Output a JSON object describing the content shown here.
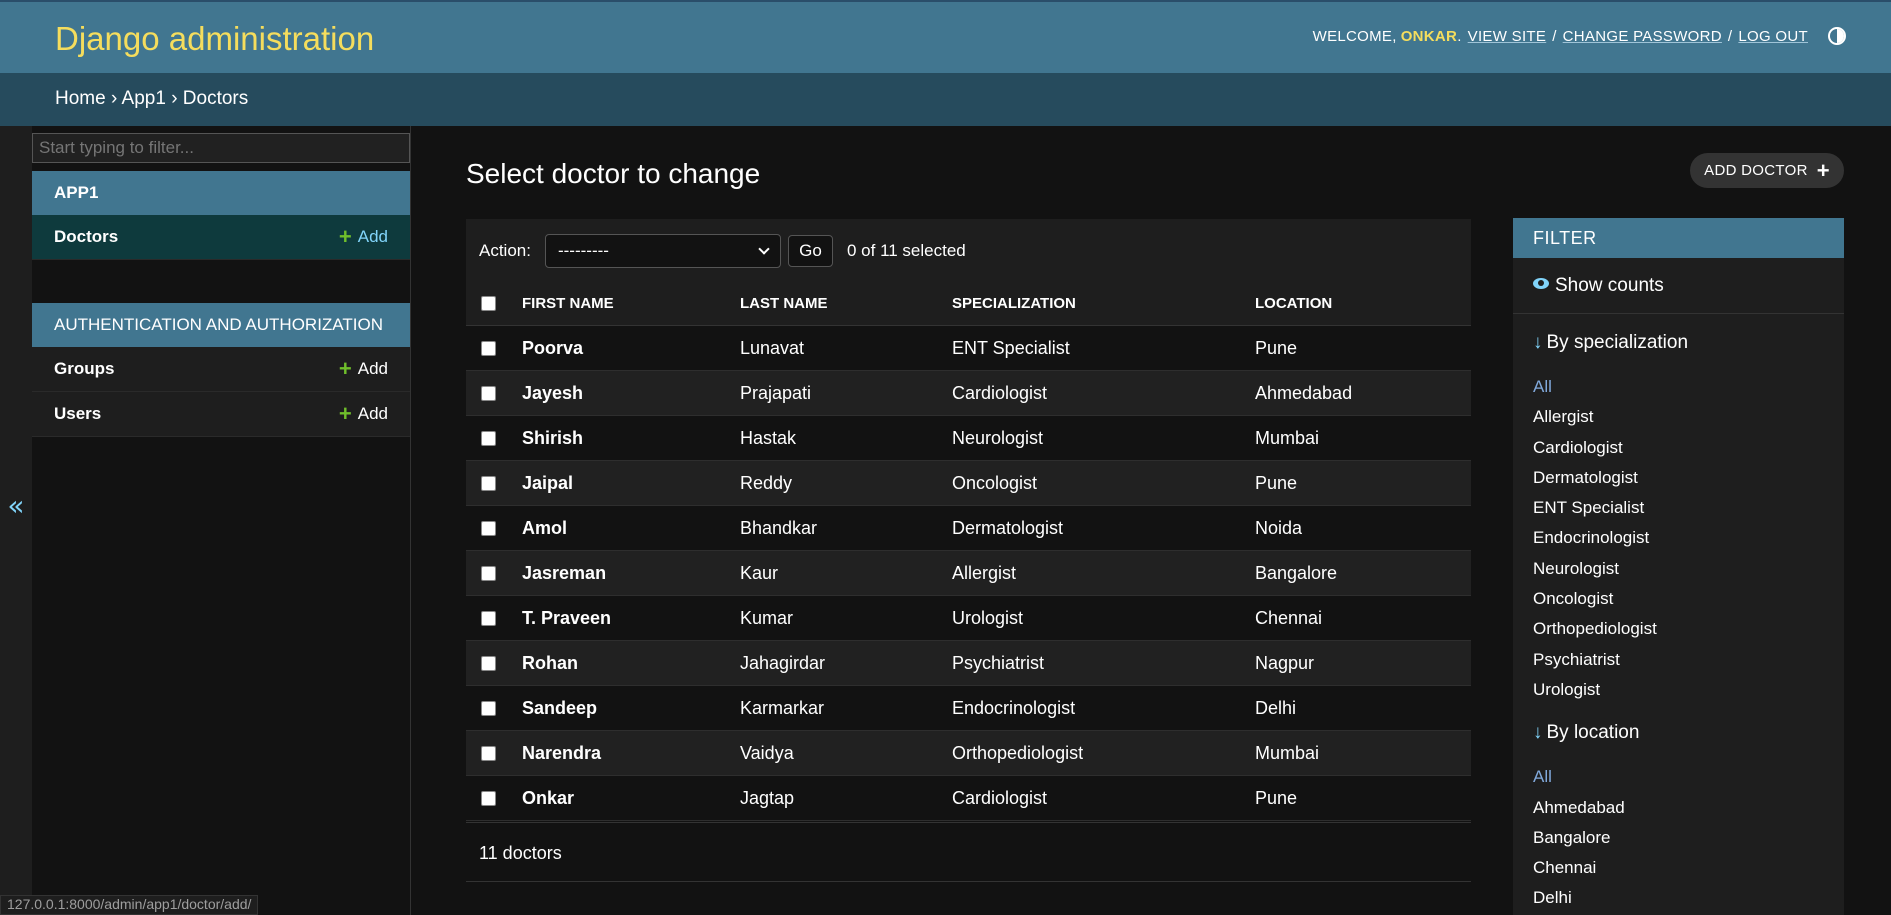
{
  "header": {
    "site_name": "Django administration",
    "welcome": "WELCOME,",
    "username": "ONKAR",
    "view_site": "VIEW SITE",
    "change_password": "CHANGE PASSWORD",
    "log_out": "LOG OUT",
    "theme_icon": "theme-toggle-icon"
  },
  "breadcrumbs": {
    "home": "Home",
    "app": "App1",
    "current": "Doctors",
    "separator": "›"
  },
  "sidebar": {
    "filter_placeholder": "Start typing to filter...",
    "toggle": "«",
    "modules": [
      {
        "caption": "APP1",
        "models": [
          {
            "name": "Doctors",
            "add": "Add"
          }
        ]
      },
      {
        "caption": "AUTHENTICATION AND AUTHORIZATION",
        "models": [
          {
            "name": "Groups",
            "add": "Add"
          },
          {
            "name": "Users",
            "add": "Add"
          }
        ]
      }
    ]
  },
  "main": {
    "title": "Select doctor to change",
    "add_button": "ADD DOCTOR",
    "actions": {
      "label": "Action:",
      "selected_value": "---------",
      "go": "Go",
      "counter": "0 of 11 selected"
    },
    "table": {
      "headers": [
        "FIRST NAME",
        "LAST NAME",
        "SPECIALIZATION",
        "LOCATION"
      ],
      "rows": [
        [
          "Poorva",
          "Lunavat",
          "ENT Specialist",
          "Pune"
        ],
        [
          "Jayesh",
          "Prajapati",
          "Cardiologist",
          "Ahmedabad"
        ],
        [
          "Shirish",
          "Hastak",
          "Neurologist",
          "Mumbai"
        ],
        [
          "Jaipal",
          "Reddy",
          "Oncologist",
          "Pune"
        ],
        [
          "Amol",
          "Bhandkar",
          "Dermatologist",
          "Noida"
        ],
        [
          "Jasreman",
          "Kaur",
          "Allergist",
          "Bangalore"
        ],
        [
          "T. Praveen",
          "Kumar",
          "Urologist",
          "Chennai"
        ],
        [
          "Rohan",
          "Jahagirdar",
          "Psychiatrist",
          "Nagpur"
        ],
        [
          "Sandeep",
          "Karmarkar",
          "Endocrinologist",
          "Delhi"
        ],
        [
          "Narendra",
          "Vaidya",
          "Orthopediologist",
          "Mumbai"
        ],
        [
          "Onkar",
          "Jagtap",
          "Cardiologist",
          "Pune"
        ]
      ]
    },
    "paginator": "11 doctors"
  },
  "filter": {
    "title": "FILTER",
    "show_counts": "Show counts",
    "sections": [
      {
        "heading": "By specialization",
        "options": [
          "All",
          "Allergist",
          "Cardiologist",
          "Dermatologist",
          "ENT Specialist",
          "Endocrinologist",
          "Neurologist",
          "Oncologist",
          "Orthopediologist",
          "Psychiatrist",
          "Urologist"
        ]
      },
      {
        "heading": "By location",
        "options": [
          "All",
          "Ahmedabad",
          "Bangalore",
          "Chennai",
          "Delhi"
        ]
      }
    ]
  },
  "status_bar": "127.0.0.1:8000/admin/app1/doctor/add/",
  "colors": {
    "header_bg": "#417690",
    "breadcrumbs_bg": "#264b5d",
    "accent_yellow": "#f5dd5d",
    "add_green": "#70bf2b",
    "link_blue": "#81d4fa"
  }
}
